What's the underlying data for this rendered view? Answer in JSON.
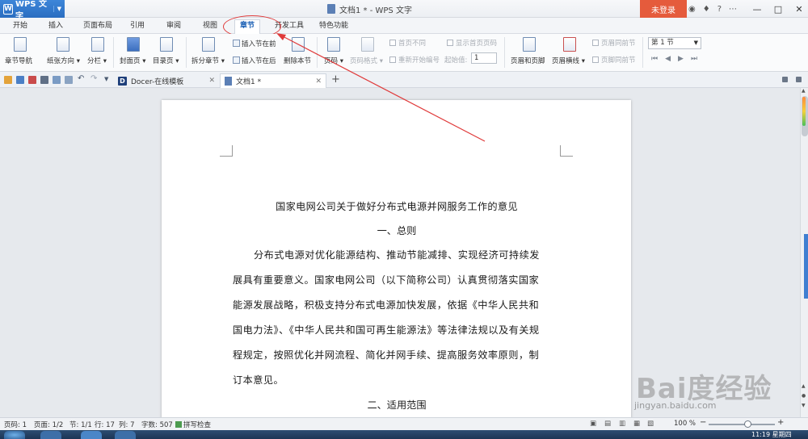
{
  "app": {
    "name": "WPS 文字",
    "doc_title": "文档1 * - WPS 文字",
    "login_label": "未登录",
    "help_label": "?"
  },
  "menu": {
    "tabs": [
      "开始",
      "插入",
      "页面布局",
      "引用",
      "审阅",
      "视图",
      "章节",
      "开发工具",
      "特色功能"
    ],
    "active": "章节"
  },
  "ribbon": {
    "nav": "章节导航",
    "orientation": "纸张方向",
    "columns": "分栏",
    "cover": "封面页",
    "toc": "目录页",
    "split": "拆分章节",
    "insert_before": "插入节在前",
    "insert_after": "插入节在后",
    "delete_section": "删除本节",
    "page_number": "页码",
    "page_number_format": "页码格式",
    "first_page_diff": "首页不同",
    "show_first_page_number": "显示首页页码",
    "restart_numbering": "重新开始编号",
    "start_value_label": "起始值:",
    "start_value": "1",
    "header_footer": "页眉和页脚",
    "header_line": "页眉横线",
    "same_as_prev_header": "页眉同前节",
    "same_as_prev_footer": "页脚同前节",
    "section_select": "第 1 节"
  },
  "doc_tabs": [
    {
      "label": "Docer-在线模板"
    },
    {
      "label": "文档1 *"
    }
  ],
  "document": {
    "title": "国家电网公司关于做好分布式电源并网服务工作的意见",
    "section1": "一、总则",
    "lines": [
      "分布式电源对优化能源结构、推动节能减排、实现经济可持续发",
      "展具有重要意义。国家电网公司（以下简称公司）认真贯彻落实国家",
      "能源发展战略，积极支持分布式电源加快发展，依据《中华人民共和",
      "国电力法》、《中华人民共和国可再生能源法》等法律法规以及有关规",
      "程规定，按照优化并网流程、简化并网手续、提高服务效率原则，制",
      "订本意见。"
    ],
    "section2": "二、适用范围"
  },
  "status": {
    "page_no": "页码: 1",
    "pages": "页面: 1/2",
    "section": "节: 1/1",
    "row": "行: 17",
    "col": "列: 7",
    "words": "字数: 507",
    "spell": "拼写检查",
    "zoom": "100 %"
  },
  "taskbar": {
    "clock": "11:19 星期四"
  },
  "watermark": {
    "text": "Bai度经验",
    "url": "jingyan.baidu.com"
  }
}
